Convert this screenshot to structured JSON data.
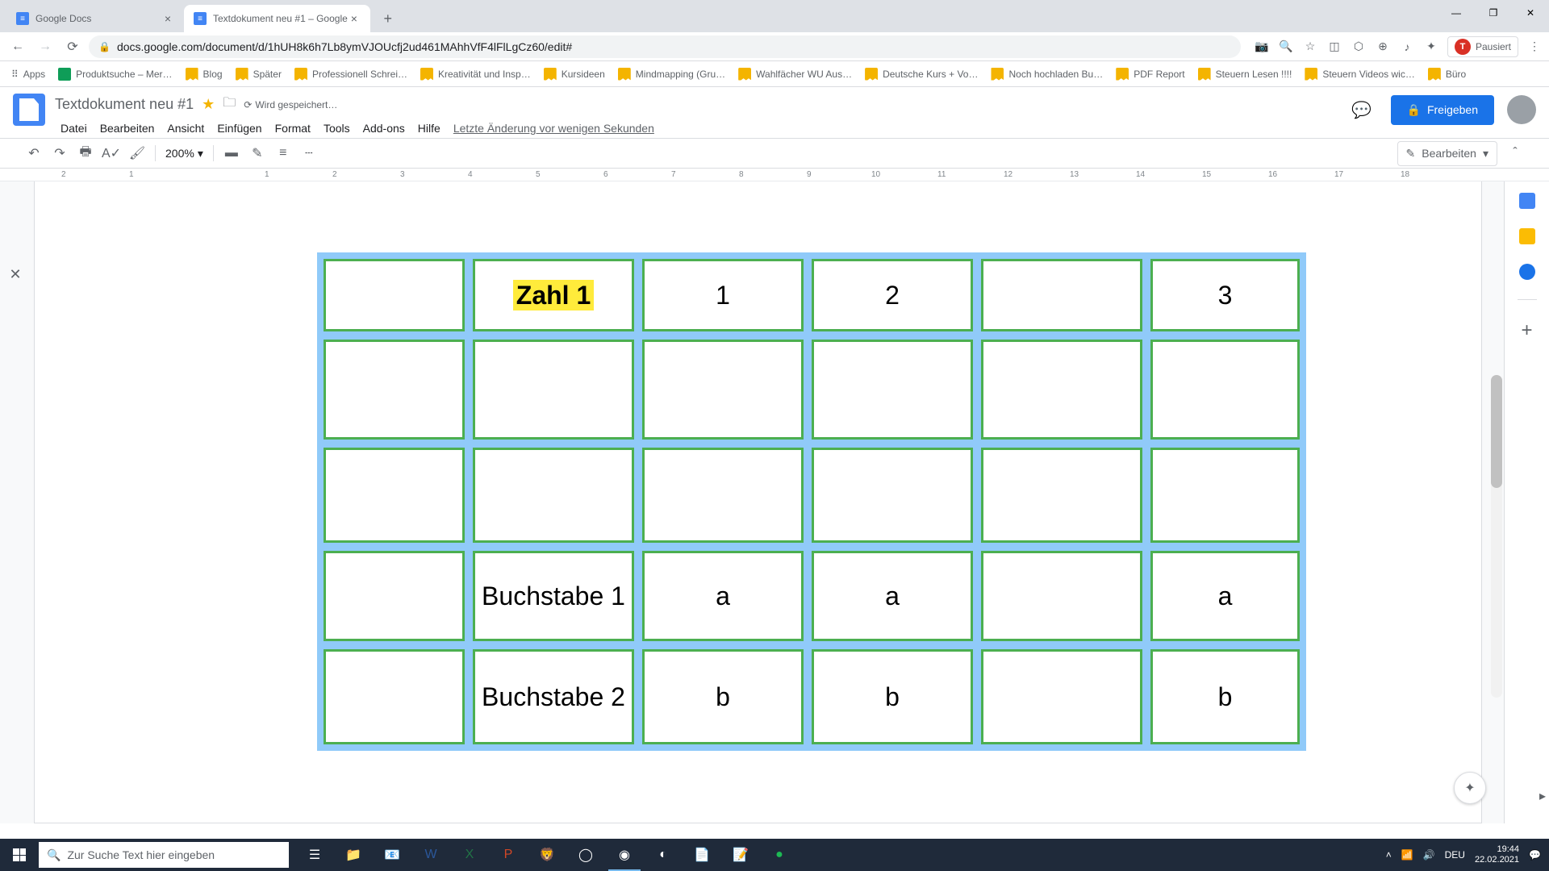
{
  "browser": {
    "tabs": [
      {
        "title": "Google Docs",
        "active": false
      },
      {
        "title": "Textdokument neu #1 – Google",
        "active": true
      }
    ],
    "url": "docs.google.com/document/d/1hUH8k6h7Lb8ymVJOUcfj2ud461MAhhVfF4lFlLgCz60/edit#",
    "paused_label": "Pausiert",
    "profile_initial": "T"
  },
  "bookmarks": {
    "apps_label": "Apps",
    "items": [
      "Produktsuche – Mer…",
      "Blog",
      "Später",
      "Professionell Schrei…",
      "Kreativität und Insp…",
      "Kursideen",
      "Mindmapping (Gru…",
      "Wahlfächer WU Aus…",
      "Deutsche Kurs + Vo…",
      "Noch hochladen Bu…",
      "PDF Report",
      "Steuern Lesen !!!!",
      "Steuern Videos wic…",
      "Büro"
    ]
  },
  "docs": {
    "title": "Textdokument neu #1",
    "save_status": "Wird gespeichert…",
    "menus": [
      "Datei",
      "Bearbeiten",
      "Ansicht",
      "Einfügen",
      "Format",
      "Tools",
      "Add-ons",
      "Hilfe"
    ],
    "last_edit": "Letzte Änderung vor wenigen Sekunden",
    "share_label": "Freigeben",
    "zoom": "200%",
    "mode_label": "Bearbeiten"
  },
  "ruler": [
    "2",
    "1",
    "",
    "1",
    "2",
    "3",
    "4",
    "5",
    "6",
    "7",
    "8",
    "9",
    "10",
    "11",
    "12",
    "13",
    "14",
    "15",
    "16",
    "17",
    "18"
  ],
  "table": {
    "rows": [
      [
        "",
        "Zahl 1",
        "1",
        "2",
        "",
        "3"
      ],
      [
        "",
        "",
        "",
        "",
        "",
        ""
      ],
      [
        "",
        "",
        "",
        "",
        "",
        ""
      ],
      [
        "",
        "Buchstabe 1",
        "a",
        "a",
        "",
        "a"
      ],
      [
        "",
        "Buchstabe 2",
        "b",
        "b",
        "",
        "b"
      ]
    ],
    "highlighted": {
      "row": 0,
      "col": 1
    }
  },
  "taskbar": {
    "search_placeholder": "Zur Suche Text hier eingeben",
    "lang": "DEU",
    "time": "19:44",
    "date": "22.02.2021"
  }
}
